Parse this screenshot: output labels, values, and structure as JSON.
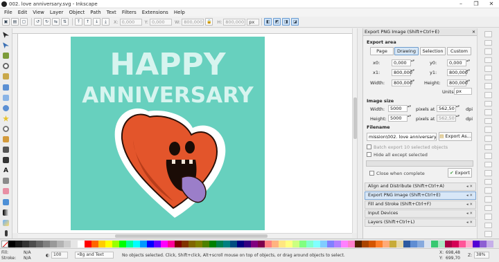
{
  "window": {
    "title": "002. love anniversary.svg - Inkscape",
    "controls": [
      "–",
      "❐",
      "✕"
    ]
  },
  "menu": [
    "File",
    "Edit",
    "View",
    "Layer",
    "Object",
    "Path",
    "Text",
    "Filters",
    "Extensions",
    "Help"
  ],
  "toolbar": {
    "x_label": "X:",
    "x_value": "0,000",
    "y_label": "Y:",
    "y_value": "0,000",
    "w_label": "W:",
    "w_value": "800,000",
    "h_label": "H:",
    "h_value": "800,000",
    "unit": "px"
  },
  "artwork": {
    "line1": "HAPPY",
    "line2": "ANNIVERSARY",
    "bg_color": "#67d0be"
  },
  "export_panel": {
    "header_title": "Export PNG Image (Shift+Ctrl+E)",
    "export_area_label": "Export area",
    "area_buttons": [
      "Page",
      "Drawing",
      "Selection",
      "Custom"
    ],
    "active_area": "Drawing",
    "x0_label": "x0:",
    "x0": "0,000",
    "y0_label": "y0:",
    "y0": "0,000",
    "x1_label": "x1:",
    "x1": "800,000",
    "y1_label": "y1:",
    "y1": "800,000",
    "width_label": "Width:",
    "width": "800,000",
    "height_label": "Height:",
    "height": "800,000",
    "units_label": "Units:",
    "units": "px",
    "image_size_label": "Image size",
    "img_width_label": "Width:",
    "img_width": "5000",
    "img_height_label": "Height:",
    "img_height": "5000",
    "ppi_label": "pixels at",
    "ppi_value": "562,50",
    "ppi_value2": "562,50",
    "dpi_label": "dpi",
    "filename_label": "Filename",
    "filename": "mission\\002. love anniversary.png",
    "export_as_button": "Export As...",
    "batch_label": "Batch export 10 selected objects",
    "hide_label": "Hide all except selected",
    "close_label": "Close when complete",
    "export_button": "Export"
  },
  "docked_dialogs": [
    {
      "label": "Align and Distribute (Shift+Ctrl+A)",
      "active": false
    },
    {
      "label": "Export PNG Image (Shift+Ctrl+E)",
      "active": true
    },
    {
      "label": "Fill and Stroke (Shift+Ctrl+F)",
      "active": false
    },
    {
      "label": "Input Devices",
      "active": false
    },
    {
      "label": "Layers (Shift+Ctrl+L)",
      "active": false
    }
  ],
  "status": {
    "fill_label": "Fill:",
    "fill_value": "N/A",
    "stroke_label": "Stroke:",
    "stroke_value": "N/A",
    "opacity_value": "100",
    "layer": "•Bg and Text",
    "message": "No objects selected. Click, Shift+click, Alt+scroll mouse on top of objects, or drag around objects to select.",
    "x_label": "X:",
    "x_value": "698,48",
    "y_label": "Y:",
    "y_value": "699,70",
    "zoom_label": "Z:",
    "zoom_value": "38%"
  },
  "palette_colors": [
    "#000000",
    "#1a1a1a",
    "#333333",
    "#4d4d4d",
    "#666666",
    "#808080",
    "#999999",
    "#b3b3b3",
    "#cccccc",
    "#e6e6e6",
    "#ffffff",
    "#ff0000",
    "#ff6600",
    "#ffcc00",
    "#ffff00",
    "#99ff00",
    "#00ff00",
    "#00ff99",
    "#00ffff",
    "#0099ff",
    "#0000ff",
    "#6600ff",
    "#ff00ff",
    "#ff0099",
    "#800000",
    "#803300",
    "#806600",
    "#808000",
    "#4d8000",
    "#008000",
    "#00804d",
    "#008080",
    "#004d80",
    "#000080",
    "#330080",
    "#800080",
    "#80004d",
    "#ff8080",
    "#ffb380",
    "#ffe680",
    "#ffff80",
    "#ccff80",
    "#80ff80",
    "#80ffcc",
    "#80ffff",
    "#80ccff",
    "#8080ff",
    "#b380ff",
    "#ff80ff",
    "#ff80cc",
    "#552200",
    "#aa4400",
    "#d45500",
    "#ff7f2a",
    "#ffaa77",
    "#c8ab37",
    "#e6d8a5",
    "#2c5aa0",
    "#5f8dd3",
    "#87aade",
    "#dbe3f0",
    "#37c871",
    "#ade7c4",
    "#aa0044",
    "#d40055",
    "#ff5599",
    "#ffaacc",
    "#5500d4",
    "#8d5fd3",
    "#c6afe9"
  ]
}
